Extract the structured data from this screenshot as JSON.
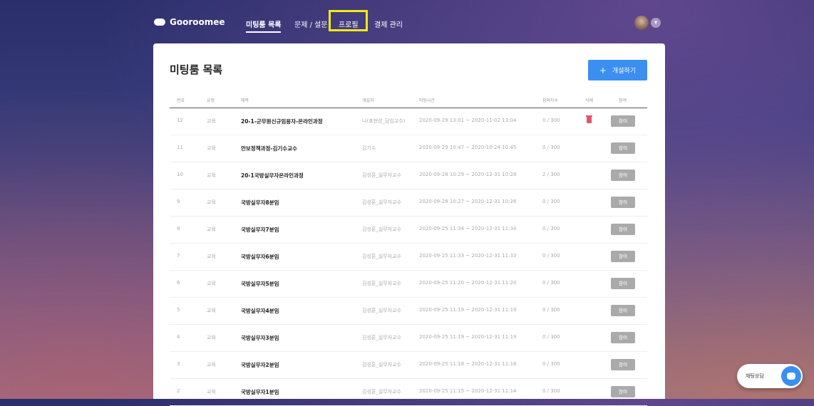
{
  "header": {
    "logo_text": "Gooroomee",
    "nav": [
      {
        "label": "미팅룸 목록"
      },
      {
        "label": "문제 / 설문"
      },
      {
        "label": "프로필"
      },
      {
        "label": "결제 관리"
      }
    ]
  },
  "main": {
    "title": "미팅룸 목록",
    "create_button": {
      "icon": "+",
      "label": "개설하기"
    },
    "columns": [
      "번호",
      "유형",
      "제목",
      "개설자",
      "미팅시간",
      "참여자수",
      "삭제",
      "참여"
    ],
    "rows": [
      {
        "no": "12",
        "type": "교육",
        "title": "20-1-군무원신규임용자-온라인과정",
        "host": "나(표현성_담임교수)",
        "time": "2020-09-29 13:01 ~ 2020-11-02 13:04",
        "participants": "0 / 300",
        "deletable": true,
        "join": "참여"
      },
      {
        "no": "11",
        "type": "교육",
        "title": "안보정책과정-김기수교수",
        "host": "김기수",
        "time": "2020-09-29 10:47 ~ 2020-10-24 10:45",
        "participants": "0 / 300",
        "deletable": false,
        "join": "참여"
      },
      {
        "no": "10",
        "type": "교육",
        "title": "20-1국방실무자온라인과정",
        "host": "김성훈_실무자교수",
        "time": "2020-09-28 10:29 ~ 2020-12-31 10:28",
        "participants": "2 / 300",
        "deletable": false,
        "join": "참여"
      },
      {
        "no": "9",
        "type": "교육",
        "title": "국방실무자8분임",
        "host": "김성훈_실무자교수",
        "time": "2020-09-28 10:27 ~ 2020-12-31 10:26",
        "participants": "0 / 300",
        "deletable": false,
        "join": "참여"
      },
      {
        "no": "8",
        "type": "교육",
        "title": "국방실무자7분임",
        "host": "김성훈_실무자교수",
        "time": "2020-09-25 11:34 ~ 2020-12-31 11:34",
        "participants": "0 / 300",
        "deletable": false,
        "join": "참여"
      },
      {
        "no": "7",
        "type": "교육",
        "title": "국방실무자6분임",
        "host": "김성훈_실무자교수",
        "time": "2020-09-25 11:33 ~ 2020-12-31 11:33",
        "participants": "0 / 300",
        "deletable": false,
        "join": "참여"
      },
      {
        "no": "6",
        "type": "교육",
        "title": "국방실무자5분임",
        "host": "김성훈_실무자교수",
        "time": "2020-09-25 11:20 ~ 2020-12-31 11:20",
        "participants": "0 / 300",
        "deletable": false,
        "join": "참여"
      },
      {
        "no": "5",
        "type": "교육",
        "title": "국방실무자4분임",
        "host": "김성훈_실무자교수",
        "time": "2020-09-25 11:19 ~ 2020-12-31 11:19",
        "participants": "0 / 300",
        "deletable": false,
        "join": "참여"
      },
      {
        "no": "4",
        "type": "교육",
        "title": "국방실무자3분임",
        "host": "김성훈_실무자교수",
        "time": "2020-09-25 11:19 ~ 2020-12-31 11:19",
        "participants": "0 / 300",
        "deletable": false,
        "join": "참여"
      },
      {
        "no": "3",
        "type": "교육",
        "title": "국방실무자2분임",
        "host": "김성훈_실무자교수",
        "time": "2020-09-25 11:18 ~ 2020-12-31 11:18",
        "participants": "0 / 300",
        "deletable": false,
        "join": "참여"
      },
      {
        "no": "2",
        "type": "교육",
        "title": "국방실무자1분임",
        "host": "김성훈_실무자교수",
        "time": "2020-09-25 11:15 ~ 2020-12-31 11:14",
        "participants": "0 / 300",
        "deletable": false,
        "join": "참여"
      }
    ]
  },
  "chat_widget": {
    "label": "채팅상담"
  },
  "colors": {
    "accent": "#3a8ff0",
    "highlight": "#f4ea12",
    "delete": "#e2556a",
    "join_button": "#aaaaaa"
  }
}
